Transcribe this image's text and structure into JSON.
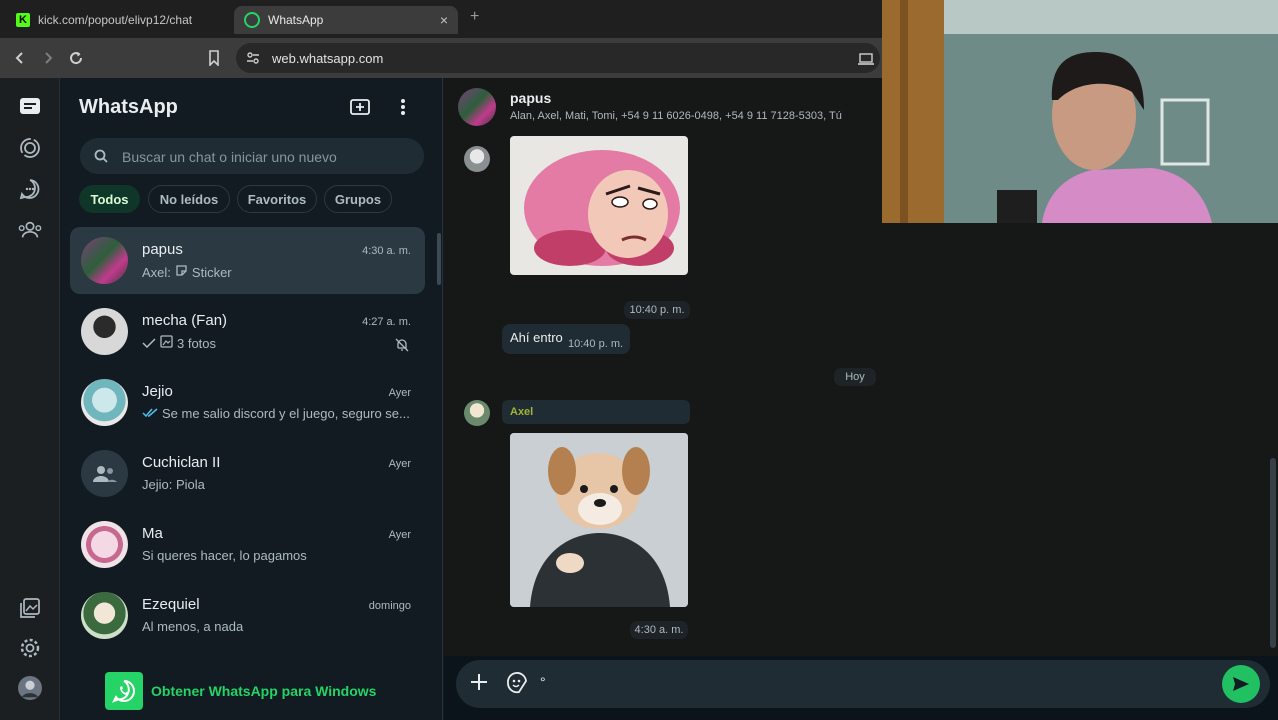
{
  "browser": {
    "tabs": [
      {
        "title": "kick.com/popout/elivp12/chat"
      },
      {
        "title": "WhatsApp",
        "close": "×"
      }
    ],
    "new_tab": "+",
    "url": "web.whatsapp.com"
  },
  "sidebar": {
    "brand": "WhatsApp",
    "search_placeholder": "Buscar un chat o iniciar uno nuevo",
    "filters": [
      "Todos",
      "No leídos",
      "Favoritos",
      "Grupos"
    ],
    "active_filter": "Todos",
    "chats": [
      {
        "name": "papus",
        "time": "4:30 a. m.",
        "preview": "Axel: ",
        "preview_extra": "Sticker"
      },
      {
        "name": "mecha (Fan)",
        "time": "4:27 a. m.",
        "preview": "3 fotos"
      },
      {
        "name": "Jejio",
        "time": "Ayer",
        "preview": "Se me salio discord y el juego, seguro se..."
      },
      {
        "name": "Cuchiclan II",
        "time": "Ayer",
        "preview": "Jejio: Piola"
      },
      {
        "name": "Ma",
        "time": "Ayer",
        "preview": "Si queres hacer, lo pagamos"
      },
      {
        "name": "Ezequiel",
        "time": "domingo",
        "preview": "Al menos, a nada"
      }
    ],
    "promo": "Obtener WhatsApp para Windows"
  },
  "conversation": {
    "name": "papus",
    "members": "Alan, Axel, Mati, Tomi, +54 9 11 6026-0498, +54 9 11 7128-5303, Tú",
    "messages": [
      {
        "type": "sticker",
        "time": "10:40 p. m."
      },
      {
        "type": "text",
        "text": "Ahí entro",
        "time": "10:40 p. m."
      },
      {
        "type": "date",
        "text": "Hoy"
      },
      {
        "type": "sender",
        "text": "Axel"
      },
      {
        "type": "sticker",
        "time": "4:30 a. m."
      }
    ],
    "composer_text": "°"
  },
  "colors": {
    "accent": "#25d366",
    "send": "#21c063",
    "sender_axel": "#a5b337"
  }
}
